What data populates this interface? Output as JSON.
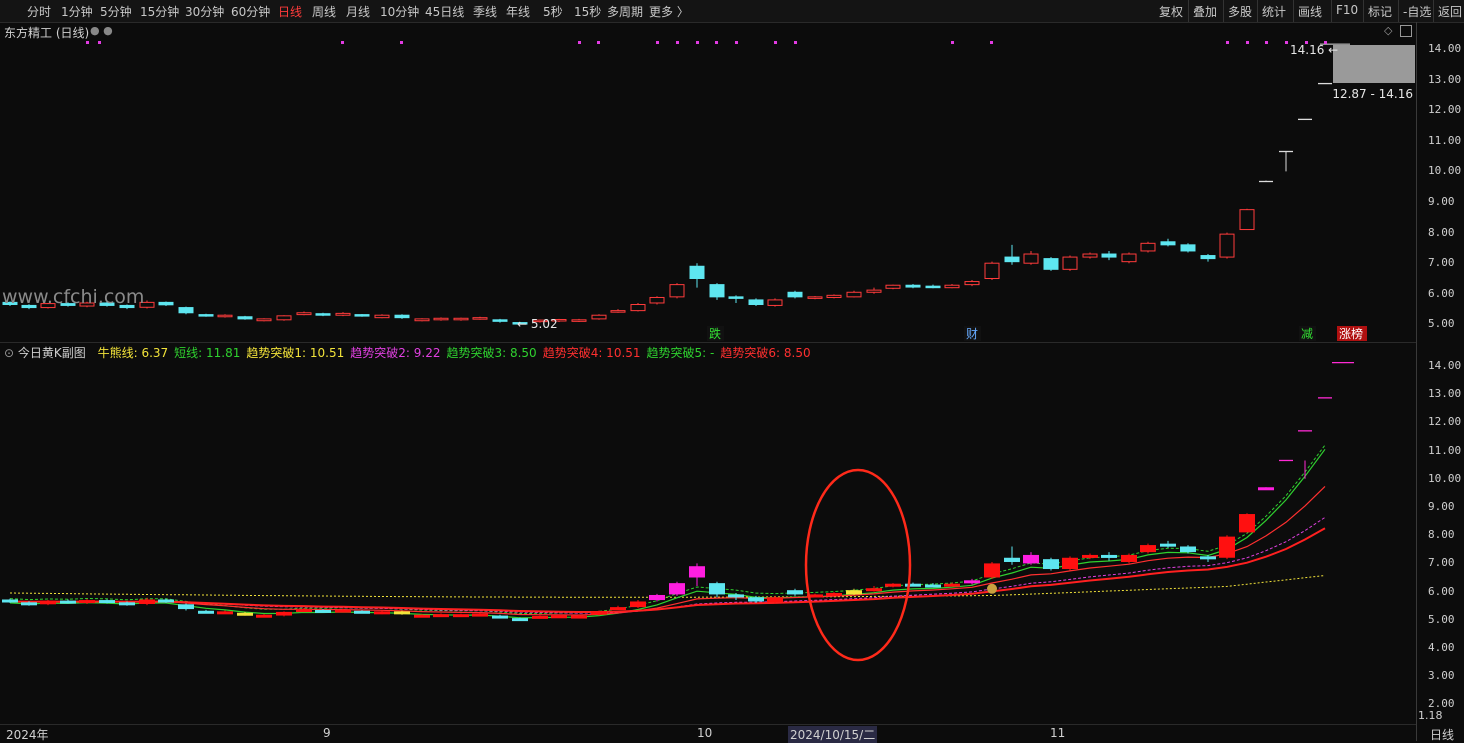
{
  "period_tabs": [
    "分时",
    "1分钟",
    "5分钟",
    "15分钟",
    "30分钟",
    "60分钟",
    "日线",
    "周线",
    "月线",
    "10分钟",
    "45日线",
    "季线",
    "年线",
    "5秒",
    "15秒",
    "多周期",
    "更多 〉"
  ],
  "active_period": "日线",
  "toolbar": [
    "复权",
    "叠加",
    "多股",
    "统计",
    "画线",
    "F10",
    "标记",
    "-自选",
    "返回"
  ],
  "stock_title": "东方精工 (日线)",
  "watermark": "www.cfchi.com",
  "main_price_ticks": [
    "14.00",
    "13.00",
    "12.00",
    "11.00",
    "10.00",
    "9.00",
    "8.00",
    "7.00",
    "6.00",
    "5.00"
  ],
  "price_label_high": "14.16",
  "price_label_low": "5.02",
  "range_box_text": "12.87 - 14.16",
  "event_markers": [
    "跌",
    "财",
    "减",
    "涨榜"
  ],
  "sub": {
    "title": "今日黄K副图",
    "legend": [
      {
        "label": "牛熊线: 6.37",
        "color": "#f2e33a"
      },
      {
        "label": "短线: 11.81",
        "color": "#2fd12f"
      },
      {
        "label": "趋势突破1: 10.51",
        "color": "#f2e33a"
      },
      {
        "label": "趋势突破2: 9.22",
        "color": "#e040e0"
      },
      {
        "label": "趋势突破3: 8.50",
        "color": "#2fd12f"
      },
      {
        "label": "趋势突破4: 10.51",
        "color": "#ff3030"
      },
      {
        "label": "趋势突破5: -",
        "color": "#2fd12f"
      },
      {
        "label": "趋势突破6: 8.50",
        "color": "#ff3030"
      }
    ],
    "ticks": [
      "14.00",
      "13.00",
      "12.00",
      "11.00",
      "10.00",
      "9.00",
      "8.00",
      "7.00",
      "6.00",
      "5.00",
      "4.00",
      "3.00",
      "2.00"
    ],
    "bottom_value": "1.18"
  },
  "x_axis": {
    "labels": [
      "2024年",
      "9",
      "10",
      "2024/10/15/二",
      "11"
    ],
    "period_label": "日线"
  },
  "colors": {
    "up": "#ff3b3b",
    "down": "#5ee6f0",
    "magenta": "#ff1ee0",
    "yellow": "#f2e33a",
    "highlight": "#ff2a1a"
  }
}
